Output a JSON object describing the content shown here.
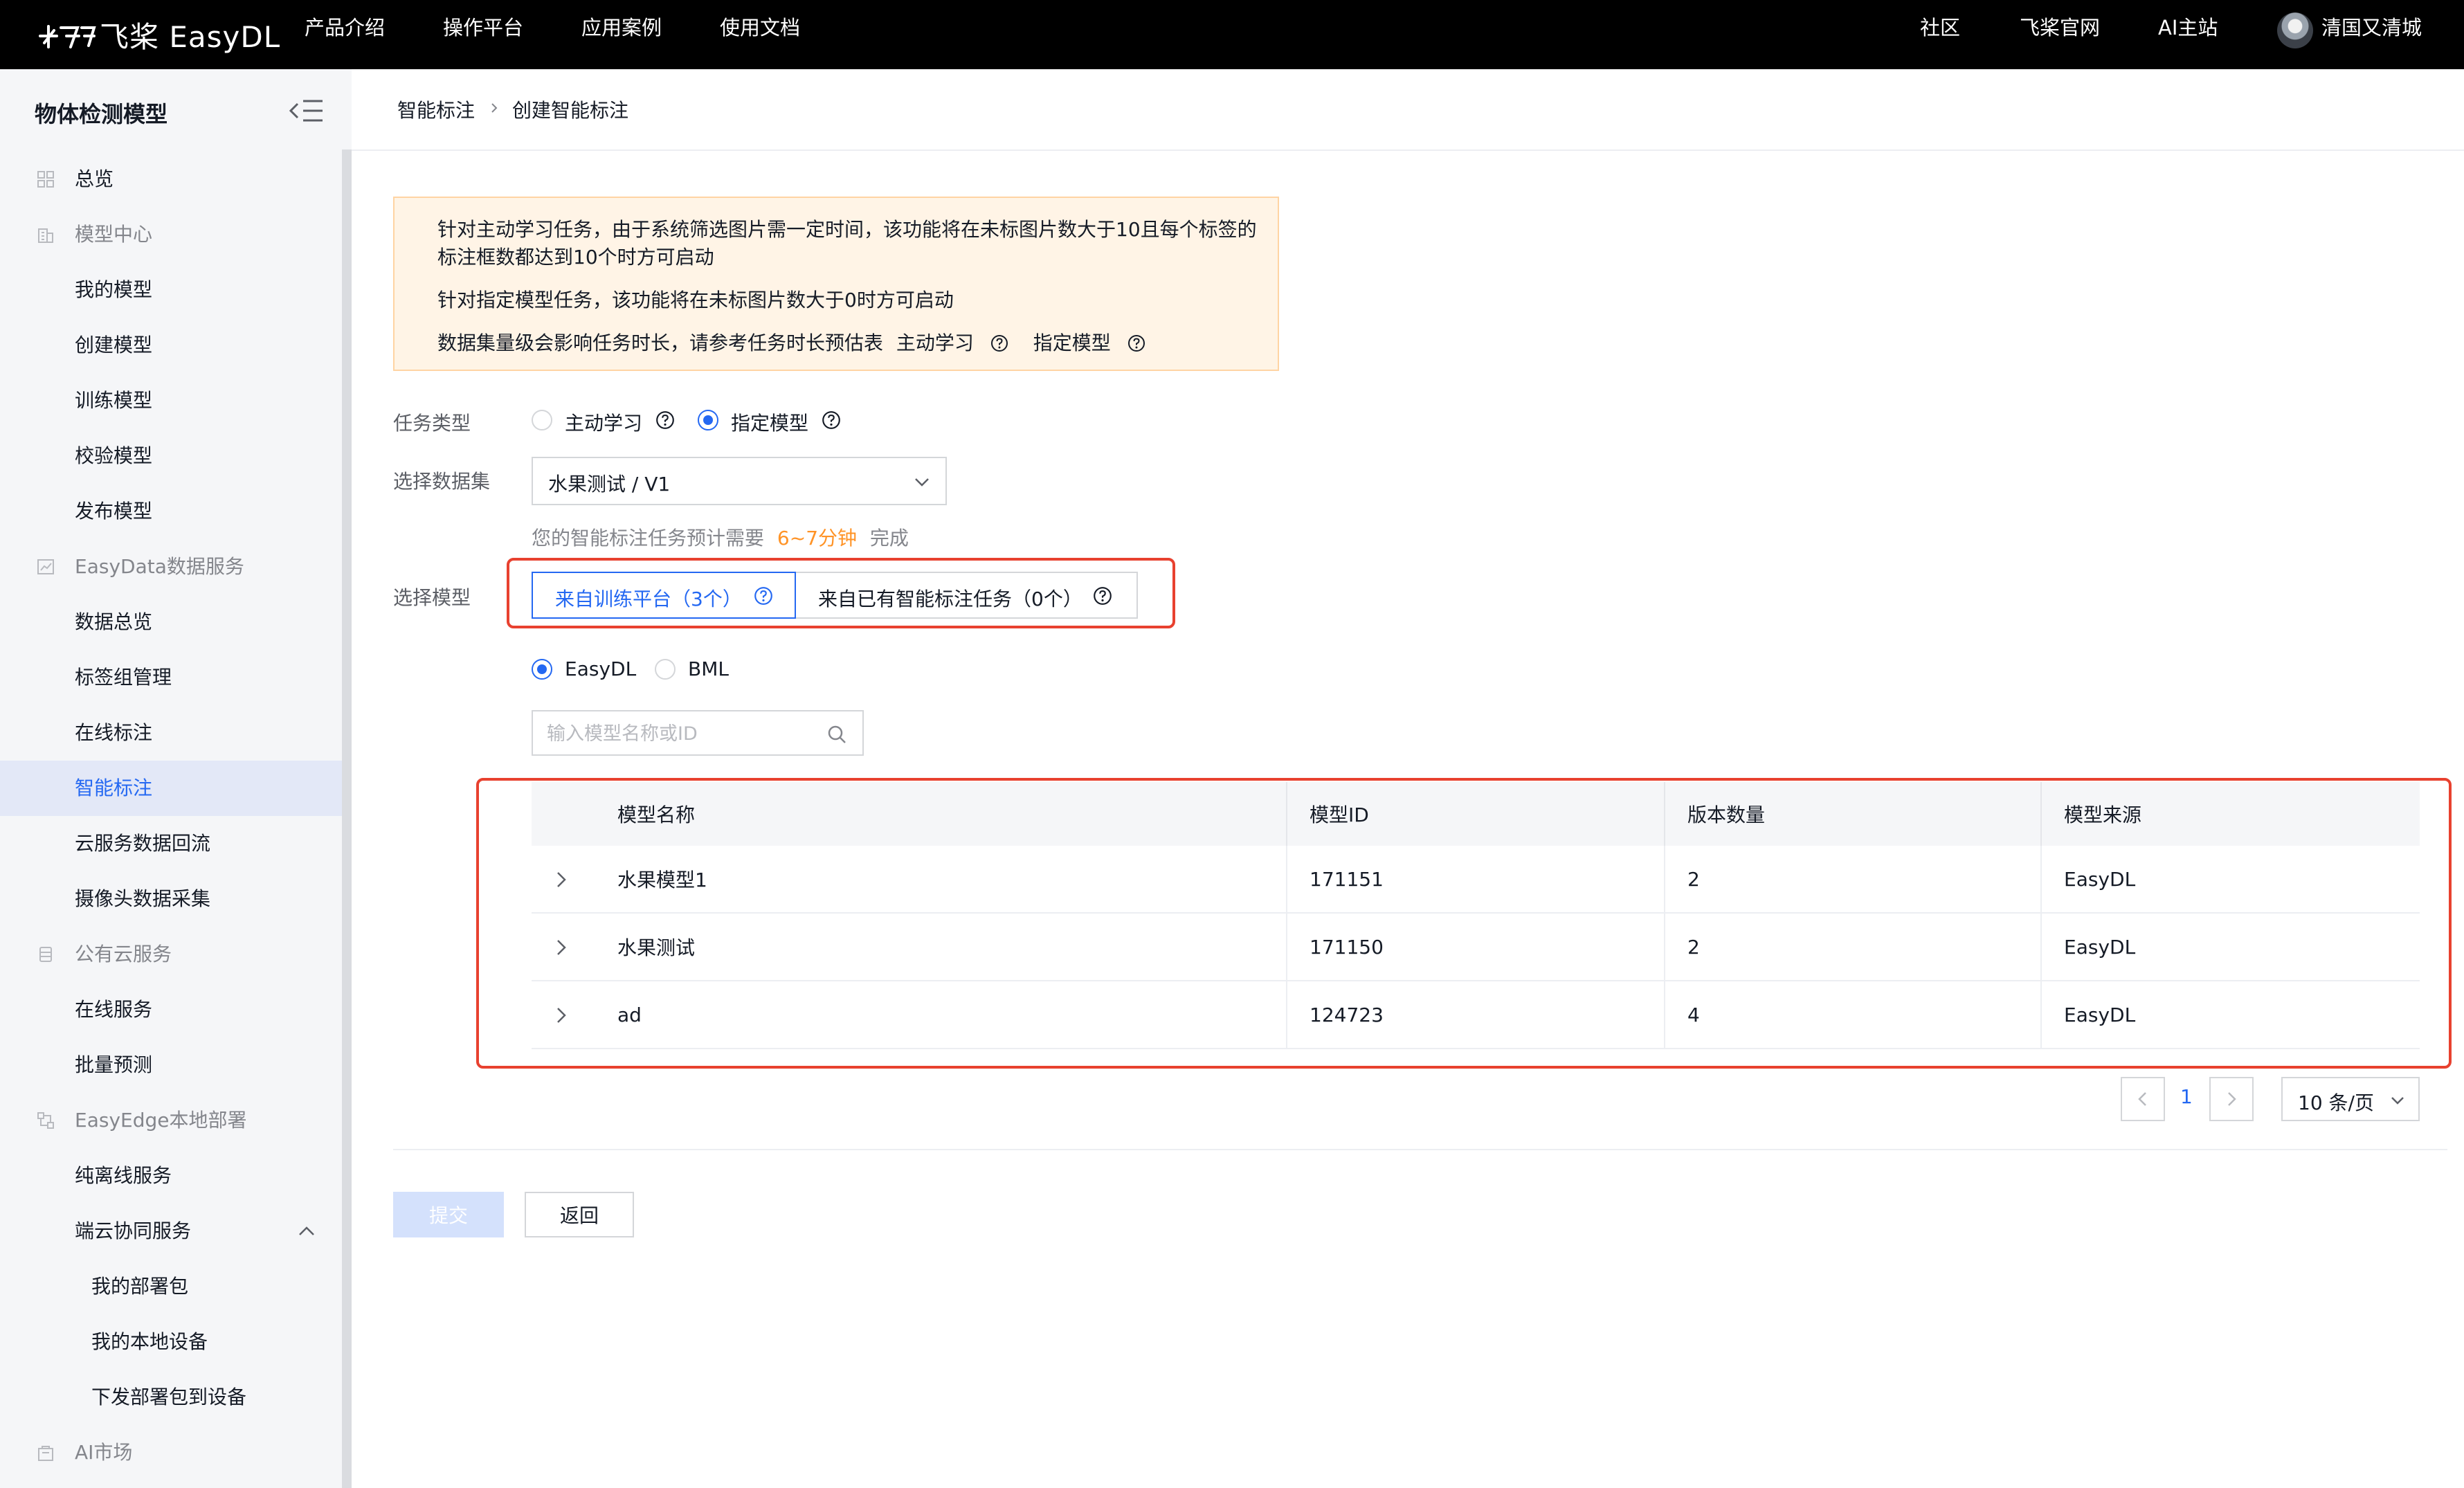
{
  "topbar": {
    "logo_text": "飞桨 EasyDL",
    "nav": [
      "产品介绍",
      "操作平台",
      "应用案例",
      "使用文档"
    ],
    "right_links": [
      "社区",
      "飞桨官网",
      "AI主站"
    ],
    "user_name": "清国又清城"
  },
  "sidebar": {
    "title": "物体检测模型",
    "items": [
      {
        "label": "总览",
        "icon": "grid-icon"
      },
      {
        "label": "模型中心",
        "icon": "building-icon"
      },
      {
        "label": "我的模型"
      },
      {
        "label": "创建模型"
      },
      {
        "label": "训练模型"
      },
      {
        "label": "校验模型"
      },
      {
        "label": "发布模型"
      },
      {
        "label": "EasyData数据服务",
        "icon": "chart-icon"
      },
      {
        "label": "数据总览"
      },
      {
        "label": "标签组管理"
      },
      {
        "label": "在线标注"
      },
      {
        "label": "智能标注"
      },
      {
        "label": "云服务数据回流"
      },
      {
        "label": "摄像头数据采集"
      },
      {
        "label": "公有云服务",
        "icon": "database-icon"
      },
      {
        "label": "在线服务"
      },
      {
        "label": "批量预测"
      },
      {
        "label": "EasyEdge本地部署",
        "icon": "edge-icon"
      },
      {
        "label": "纯离线服务"
      },
      {
        "label": "端云协同服务"
      },
      {
        "label": "我的部署包"
      },
      {
        "label": "我的本地设备"
      },
      {
        "label": "下发部署包到设备"
      },
      {
        "label": "AI市场",
        "icon": "market-icon"
      }
    ]
  },
  "breadcrumb": {
    "parent": "智能标注",
    "current": "创建智能标注"
  },
  "notice": {
    "line1": "针对主动学习任务，由于系统筛选图片需一定时间，该功能将在未标图片数大于10且每个标签的",
    "line2": "标注框数都达到10个时方可启动",
    "line3": "针对指定模型任务，该功能将在未标图片数大于0时方可启动",
    "line4": "数据集量级会影响任务时长，请参考任务时长预估表",
    "link1": "主动学习",
    "link2": "指定模型"
  },
  "form": {
    "task_type_label": "任务类型",
    "task_type_options": [
      "主动学习",
      "指定模型"
    ],
    "task_type_selected": "指定模型",
    "dataset_label": "选择数据集",
    "dataset_value": "水果测试 / V1",
    "hint_prefix": "您的智能标注任务预计需要",
    "hint_time": "6~7分钟",
    "hint_suffix": "完成",
    "model_label": "选择模型",
    "model_tabs": [
      "来自训练平台（3个）",
      "来自已有智能标注任务（0个）"
    ],
    "platform_options": [
      "EasyDL",
      "BML"
    ],
    "platform_selected": "EasyDL",
    "search_placeholder": "输入模型名称或ID"
  },
  "table": {
    "columns": [
      "模型名称",
      "模型ID",
      "版本数量",
      "模型来源"
    ],
    "rows": [
      [
        "水果模型1",
        "171151",
        "2",
        "EasyDL"
      ],
      [
        "水果测试",
        "171150",
        "2",
        "EasyDL"
      ],
      [
        "ad",
        "124723",
        "4",
        "EasyDL"
      ]
    ]
  },
  "pagination": {
    "current_page": "1",
    "page_size": "10 条/页"
  },
  "actions": {
    "submit": "提交",
    "back": "返回"
  },
  "colors": {
    "primary": "#2468f2",
    "warning_text": "#ff9326",
    "highlight_box": "#e8412f",
    "active_sidebar_bg": "#e3e8f7"
  }
}
